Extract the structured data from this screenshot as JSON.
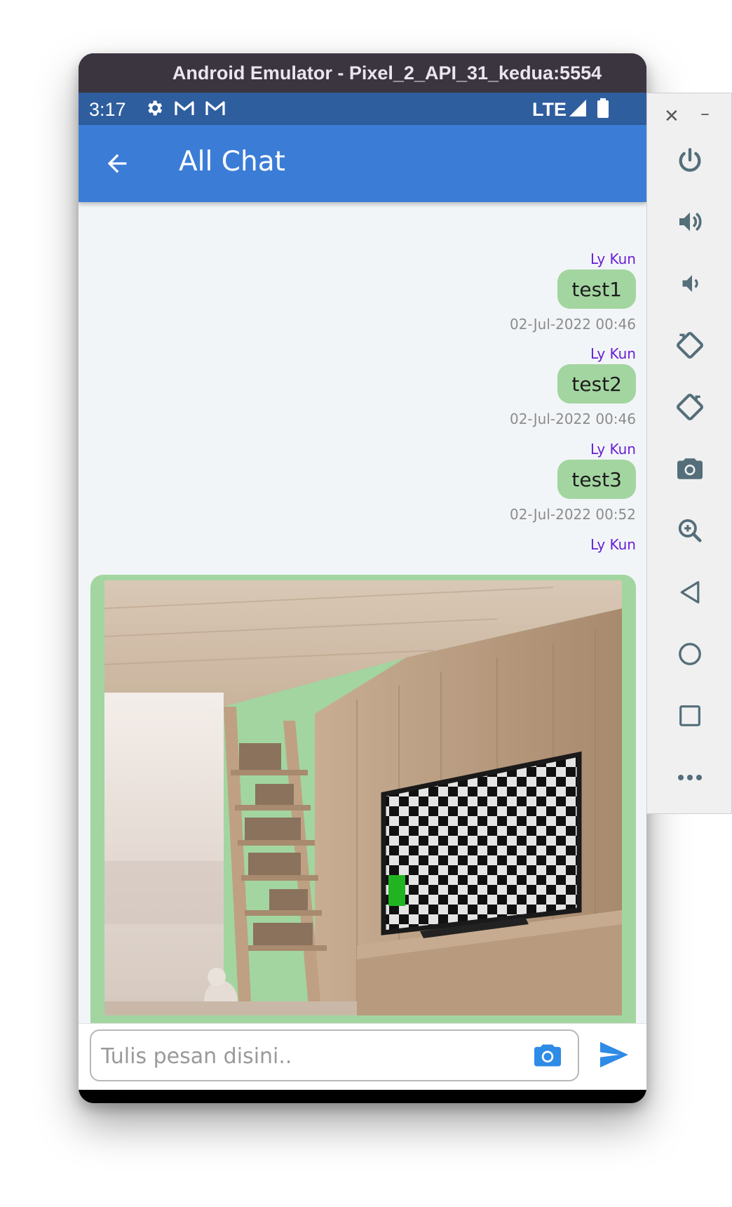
{
  "window": {
    "title": "Android Emulator - Pixel_2_API_31_kedua:5554"
  },
  "status_bar": {
    "time": "3:17",
    "network": "LTE",
    "icons": [
      "gear-icon",
      "gmail-icon",
      "gmail-icon",
      "signal-icon",
      "battery-icon"
    ]
  },
  "app_bar": {
    "title": "All Chat",
    "back_icon": "arrow-back-icon"
  },
  "messages": [
    {
      "sender": "Ly Kun",
      "text": "test1",
      "timestamp": "02-Jul-2022 00:46"
    },
    {
      "sender": "Ly Kun",
      "text": "test2",
      "timestamp": "02-Jul-2022 00:46"
    },
    {
      "sender": "Ly Kun",
      "text": "test3",
      "timestamp": "02-Jul-2022 00:52"
    },
    {
      "sender": "Ly Kun",
      "type": "image"
    }
  ],
  "composer": {
    "placeholder": "Tulis pesan disini..",
    "value": "",
    "camera_icon": "camera-icon",
    "send_icon": "send-icon"
  },
  "system_nav": [
    "back-triangle-icon",
    "home-circle-icon",
    "recents-square-icon"
  ],
  "emulator_toolbar": {
    "window_controls": [
      "close-icon",
      "minimize-icon"
    ],
    "buttons": [
      "power-icon",
      "volume-up-icon",
      "volume-down-icon",
      "rotate-left-icon",
      "rotate-right-icon",
      "screenshot-camera-icon",
      "zoom-icon",
      "back-icon",
      "home-icon",
      "overview-icon",
      "more-icon"
    ]
  },
  "colors": {
    "app_bar": "#3b7dd6",
    "status_bar": "#2f5e9e",
    "bubble": "#a3d5a0",
    "sender_name": "#6a1fd6",
    "accent": "#2e8be6"
  }
}
